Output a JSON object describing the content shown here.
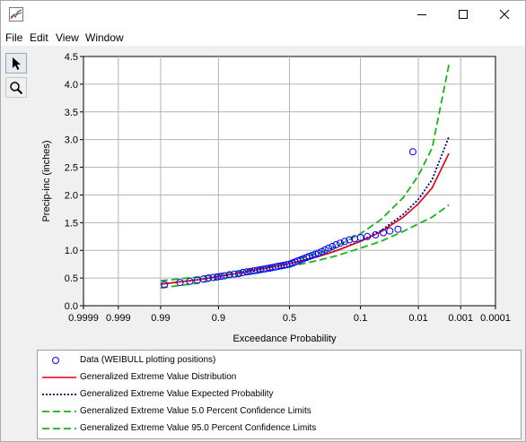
{
  "menu": {
    "file": "File",
    "edit": "Edit",
    "view": "View",
    "window": "Window"
  },
  "chart_data": {
    "type": "scatter",
    "xlabel": "Exceedance Probability",
    "ylabel": "Precip-inc (inches)",
    "x_scale": "normal-probability",
    "x_ticks": [
      "0.9999",
      "0.999",
      "0.99",
      "0.9",
      "0.5",
      "0.1",
      "0.01",
      "0.001",
      "0.0001"
    ],
    "y_ticks": [
      "0.0",
      "0.5",
      "1.0",
      "1.5",
      "2.0",
      "2.5",
      "3.0",
      "3.5",
      "4.0",
      "4.5"
    ],
    "ylim": [
      0,
      4.5
    ],
    "grid": true,
    "legend_placement": "bottom",
    "series": [
      {
        "name": "Data (WEIBULL plotting positions)",
        "style": "circle-marker",
        "color": "#0000ff",
        "x": [
          0.988,
          0.976,
          0.964,
          0.952,
          0.94,
          0.928,
          0.916,
          0.904,
          0.892,
          0.88,
          0.86,
          0.84,
          0.82,
          0.8,
          0.78,
          0.76,
          0.74,
          0.72,
          0.7,
          0.68,
          0.66,
          0.64,
          0.62,
          0.6,
          0.58,
          0.56,
          0.54,
          0.52,
          0.5,
          0.48,
          0.46,
          0.44,
          0.42,
          0.4,
          0.38,
          0.36,
          0.34,
          0.32,
          0.3,
          0.28,
          0.26,
          0.24,
          0.22,
          0.2,
          0.18,
          0.16,
          0.14,
          0.12,
          0.1,
          0.08,
          0.06,
          0.045,
          0.035,
          0.025,
          0.013
        ],
        "y": [
          0.38,
          0.42,
          0.44,
          0.46,
          0.48,
          0.5,
          0.51,
          0.52,
          0.53,
          0.54,
          0.56,
          0.57,
          0.58,
          0.6,
          0.61,
          0.62,
          0.63,
          0.64,
          0.65,
          0.66,
          0.67,
          0.68,
          0.69,
          0.7,
          0.71,
          0.72,
          0.73,
          0.74,
          0.75,
          0.77,
          0.79,
          0.81,
          0.83,
          0.85,
          0.87,
          0.89,
          0.91,
          0.93,
          0.95,
          0.98,
          1.01,
          1.04,
          1.07,
          1.1,
          1.13,
          1.16,
          1.19,
          1.21,
          1.23,
          1.25,
          1.28,
          1.32,
          1.35,
          1.38,
          2.78
        ]
      },
      {
        "name": "Generalized Extreme Value Distribution",
        "style": "solid",
        "color": "#e8000b",
        "x": [
          0.99,
          0.95,
          0.9,
          0.8,
          0.7,
          0.6,
          0.5,
          0.4,
          0.3,
          0.2,
          0.1,
          0.05,
          0.02,
          0.01,
          0.005,
          0.002
        ],
        "y": [
          0.39,
          0.47,
          0.53,
          0.6,
          0.66,
          0.71,
          0.76,
          0.82,
          0.89,
          0.99,
          1.16,
          1.33,
          1.6,
          1.84,
          2.13,
          2.75
        ]
      },
      {
        "name": "Generalized Extreme Value Expected Probability",
        "style": "dotted",
        "color": "#00008b",
        "x": [
          0.99,
          0.95,
          0.9,
          0.8,
          0.7,
          0.6,
          0.5,
          0.4,
          0.3,
          0.2,
          0.1,
          0.05,
          0.02,
          0.01,
          0.005,
          0.002
        ],
        "y": [
          0.39,
          0.47,
          0.53,
          0.6,
          0.66,
          0.71,
          0.76,
          0.82,
          0.89,
          0.99,
          1.17,
          1.35,
          1.65,
          1.92,
          2.28,
          3.05
        ]
      },
      {
        "name": "Generalized Extreme Value 5.0 Percent Confidence Limits",
        "style": "dashed",
        "color": "#18b418",
        "x": [
          0.99,
          0.95,
          0.9,
          0.8,
          0.7,
          0.6,
          0.5,
          0.4,
          0.3,
          0.2,
          0.1,
          0.05,
          0.02,
          0.01,
          0.005,
          0.002
        ],
        "y": [
          0.45,
          0.52,
          0.57,
          0.63,
          0.69,
          0.74,
          0.8,
          0.87,
          0.95,
          1.07,
          1.3,
          1.55,
          1.95,
          2.35,
          2.85,
          4.35
        ]
      },
      {
        "name": "Generalized Extreme Value 95.0 Percent Confidence Limits",
        "style": "dashed",
        "color": "#18b418",
        "x": [
          0.99,
          0.95,
          0.9,
          0.8,
          0.7,
          0.6,
          0.5,
          0.4,
          0.3,
          0.2,
          0.1,
          0.05,
          0.02,
          0.01,
          0.005,
          0.002
        ],
        "y": [
          0.32,
          0.41,
          0.48,
          0.55,
          0.61,
          0.66,
          0.71,
          0.76,
          0.82,
          0.9,
          1.04,
          1.16,
          1.34,
          1.48,
          1.6,
          1.82
        ]
      }
    ]
  }
}
